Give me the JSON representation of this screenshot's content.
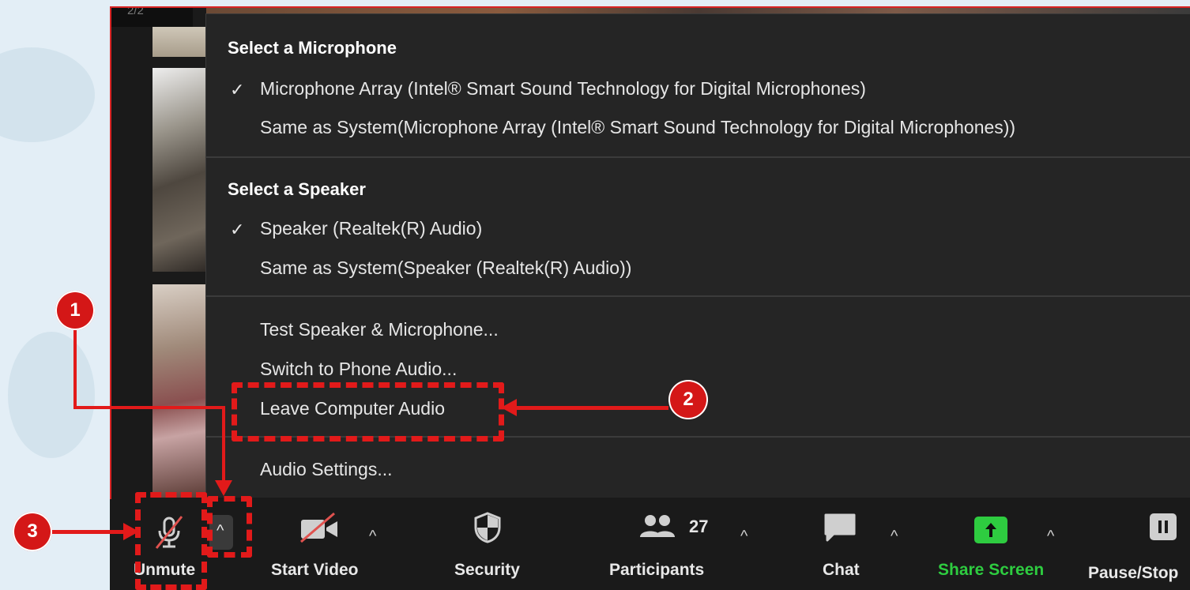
{
  "page_indicator": "2/2",
  "audio_menu": {
    "microphone_heading": "Select a Microphone",
    "microphone_items": [
      {
        "label": "Microphone Array (Intel® Smart Sound Technology for Digital Microphones)",
        "checked": "✓"
      },
      {
        "label": "Same as System(Microphone Array (Intel® Smart Sound Technology for Digital Microphones))",
        "checked": ""
      }
    ],
    "speaker_heading": "Select a Speaker",
    "speaker_items": [
      {
        "label": "Speaker (Realtek(R) Audio)",
        "checked": "✓"
      },
      {
        "label": "Same as System(Speaker (Realtek(R) Audio))",
        "checked": ""
      }
    ],
    "actions": [
      "Test Speaker & Microphone...",
      "Switch to Phone Audio...",
      "Leave Computer Audio"
    ],
    "settings": "Audio Settings..."
  },
  "toolbar": {
    "unmute": "Unmute",
    "caret": "^",
    "start_video": "Start Video",
    "security": "Security",
    "participants": "Participants",
    "participants_count": "27",
    "chat": "Chat",
    "share_screen": "Share Screen",
    "pause_stop": "Pause/Stop",
    "share_color": "#2ecc40"
  },
  "annotations": {
    "badge_1": "1",
    "badge_2": "2",
    "badge_3": "3",
    "color": "#e21a1a"
  }
}
